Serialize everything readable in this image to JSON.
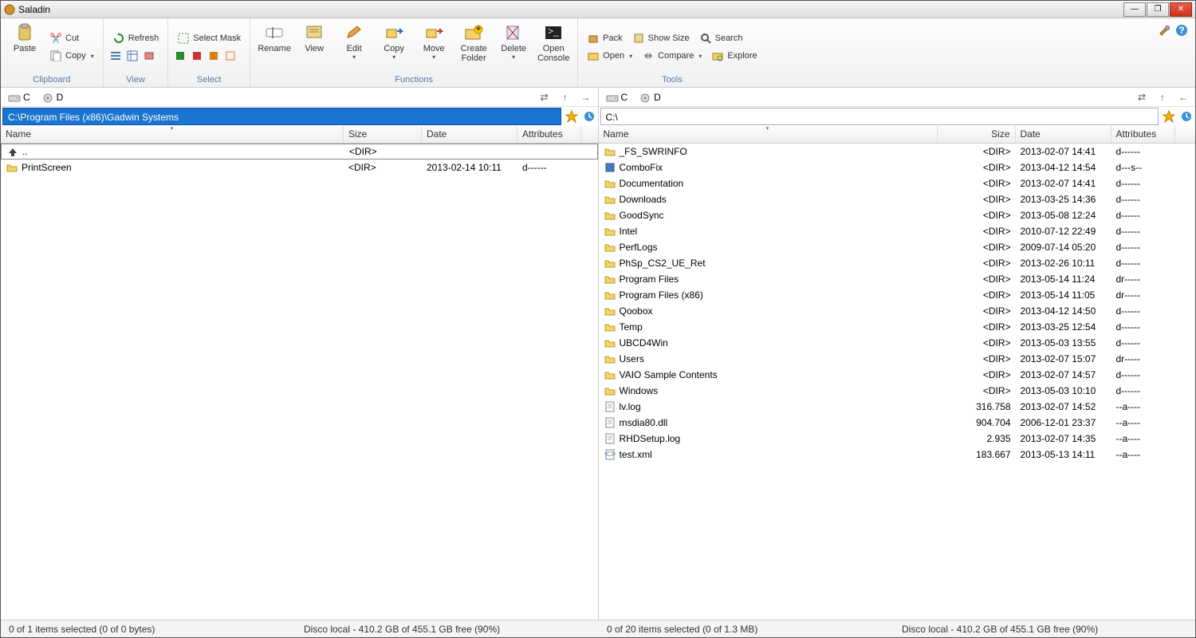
{
  "title": "Saladin",
  "ribbon": {
    "groups": {
      "clipboard": {
        "label": "Clipboard",
        "paste": "Paste",
        "cut": "Cut",
        "copy": "Copy"
      },
      "view": {
        "label": "View",
        "refresh": "Refresh"
      },
      "select": {
        "label": "Select",
        "mask": "Select Mask"
      },
      "functions": {
        "label": "Functions",
        "rename": "Rename",
        "view": "View",
        "edit": "Edit",
        "copy": "Copy",
        "move": "Move",
        "create": "Create\nFolder",
        "delete": "Delete",
        "console": "Open\nConsole"
      },
      "tools": {
        "label": "Tools",
        "pack": "Pack",
        "showsize": "Show Size",
        "search": "Search",
        "open": "Open",
        "compare": "Compare",
        "explore": "Explore"
      }
    }
  },
  "drives": {
    "c": "C",
    "d": "D"
  },
  "columns": {
    "name": "Name",
    "size": "Size",
    "date": "Date",
    "attr": "Attributes"
  },
  "left": {
    "path": "C:\\Program Files (x86)\\Gadwin Systems",
    "rows": [
      {
        "icon": "up",
        "name": "..",
        "size": "<DIR>",
        "date": "",
        "attr": "",
        "sel": true
      },
      {
        "icon": "folder",
        "name": "PrintScreen",
        "size": "<DIR>",
        "date": "2013-02-14 10:11",
        "attr": "d------"
      }
    ],
    "status_sel": "0 of 1 items selected (0 of 0 bytes)",
    "status_disk": "Disco local - 410.2 GB of 455.1 GB free (90%)"
  },
  "right": {
    "path": "C:\\",
    "rows": [
      {
        "icon": "folder",
        "name": "_FS_SWRINFO",
        "size": "<DIR>",
        "date": "2013-02-07 14:41",
        "attr": "d------"
      },
      {
        "icon": "app",
        "name": "ComboFix",
        "size": "<DIR>",
        "date": "2013-04-12 14:54",
        "attr": "d---s--"
      },
      {
        "icon": "folder",
        "name": "Documentation",
        "size": "<DIR>",
        "date": "2013-02-07 14:41",
        "attr": "d------"
      },
      {
        "icon": "folder",
        "name": "Downloads",
        "size": "<DIR>",
        "date": "2013-03-25 14:36",
        "attr": "d------"
      },
      {
        "icon": "folder",
        "name": "GoodSync",
        "size": "<DIR>",
        "date": "2013-05-08 12:24",
        "attr": "d------"
      },
      {
        "icon": "folder",
        "name": "Intel",
        "size": "<DIR>",
        "date": "2010-07-12 22:49",
        "attr": "d------"
      },
      {
        "icon": "folder",
        "name": "PerfLogs",
        "size": "<DIR>",
        "date": "2009-07-14 05:20",
        "attr": "d------"
      },
      {
        "icon": "folder",
        "name": "PhSp_CS2_UE_Ret",
        "size": "<DIR>",
        "date": "2013-02-26 10:11",
        "attr": "d------"
      },
      {
        "icon": "folder",
        "name": "Program Files",
        "size": "<DIR>",
        "date": "2013-05-14 11:24",
        "attr": "dr-----"
      },
      {
        "icon": "folder",
        "name": "Program Files (x86)",
        "size": "<DIR>",
        "date": "2013-05-14 11:05",
        "attr": "dr-----"
      },
      {
        "icon": "folder",
        "name": "Qoobox",
        "size": "<DIR>",
        "date": "2013-04-12 14:50",
        "attr": "d------"
      },
      {
        "icon": "folder",
        "name": "Temp",
        "size": "<DIR>",
        "date": "2013-03-25 12:54",
        "attr": "d------"
      },
      {
        "icon": "folder",
        "name": "UBCD4Win",
        "size": "<DIR>",
        "date": "2013-05-03 13:55",
        "attr": "d------"
      },
      {
        "icon": "folder",
        "name": "Users",
        "size": "<DIR>",
        "date": "2013-02-07 15:07",
        "attr": "dr-----"
      },
      {
        "icon": "folder",
        "name": "VAIO Sample Contents",
        "size": "<DIR>",
        "date": "2013-02-07 14:57",
        "attr": "d------"
      },
      {
        "icon": "folder",
        "name": "Windows",
        "size": "<DIR>",
        "date": "2013-05-03 10:10",
        "attr": "d------"
      },
      {
        "icon": "file",
        "name": "lv.log",
        "size": "316.758",
        "date": "2013-02-07 14:52",
        "attr": "--a----"
      },
      {
        "icon": "file",
        "name": "msdia80.dll",
        "size": "904.704",
        "date": "2006-12-01 23:37",
        "attr": "--a----"
      },
      {
        "icon": "file",
        "name": "RHDSetup.log",
        "size": "2.935",
        "date": "2013-02-07 14:35",
        "attr": "--a----"
      },
      {
        "icon": "xml",
        "name": "test.xml",
        "size": "183.667",
        "date": "2013-05-13 14:11",
        "attr": "--a----"
      }
    ],
    "status_sel": "0 of 20 items selected (0 of 1.3 MB)",
    "status_disk": "Disco local - 410.2 GB of 455.1 GB free (90%)"
  }
}
